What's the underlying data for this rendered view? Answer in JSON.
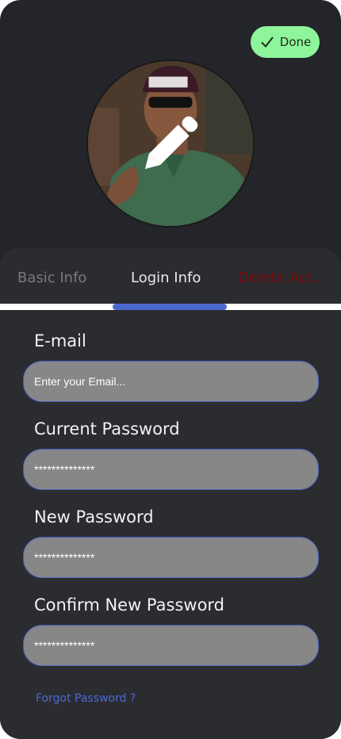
{
  "header": {
    "done_label": "Done"
  },
  "tabs": [
    {
      "label": "Basic Info",
      "active": false
    },
    {
      "label": "Login Info",
      "active": true
    },
    {
      "label": "Delete Acc.",
      "active": false
    }
  ],
  "form": {
    "email": {
      "label": "E-mail",
      "placeholder": "Enter your Email...",
      "value": ""
    },
    "current_password": {
      "label": "Current Password",
      "value": "**************"
    },
    "new_password": {
      "label": "New Password",
      "value": "**************"
    },
    "confirm_password": {
      "label": "Confirm New Password",
      "value": "**************"
    },
    "forgot_link": "Forgot Password ?"
  },
  "colors": {
    "accent": "#4a6ad0",
    "done_bg": "#8ef59b",
    "danger": "#7a0b0b",
    "background": "#24252b"
  },
  "icons": {
    "done": "checkmark-icon",
    "edit": "pencil-icon"
  }
}
